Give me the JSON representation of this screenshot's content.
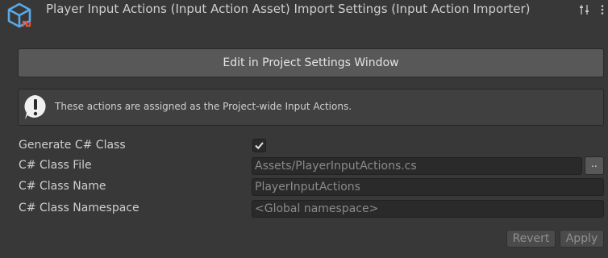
{
  "header": {
    "title": "Player Input Actions (Input Action Asset) Import Settings (Input Action Importer)",
    "icons": [
      "input-action-asset-icon",
      "sliders-icon",
      "kebab-menu-icon"
    ]
  },
  "edit_button": {
    "label": "Edit in Project Settings Window"
  },
  "help_box": {
    "icon": "info-exclamation-icon",
    "text": "These actions are assigned as the Project-wide Input Actions."
  },
  "properties": {
    "generate_class": {
      "label": "Generate C# Class",
      "checked": true
    },
    "class_file": {
      "label": "C# Class File",
      "value": "Assets/PlayerInputActions.cs",
      "browse_label": ".."
    },
    "class_name": {
      "label": "C# Class Name",
      "value": "PlayerInputActions"
    },
    "class_namespace": {
      "label": "C# Class Namespace",
      "value": "",
      "placeholder": "<Global namespace>"
    }
  },
  "footer": {
    "revert_label": "Revert",
    "apply_label": "Apply"
  },
  "colors": {
    "background": "#383838",
    "field": "#2a2a2a",
    "button": "#585858",
    "accent_icon": "#5aa9e6",
    "accent_icon_secondary": "#e5533d"
  }
}
